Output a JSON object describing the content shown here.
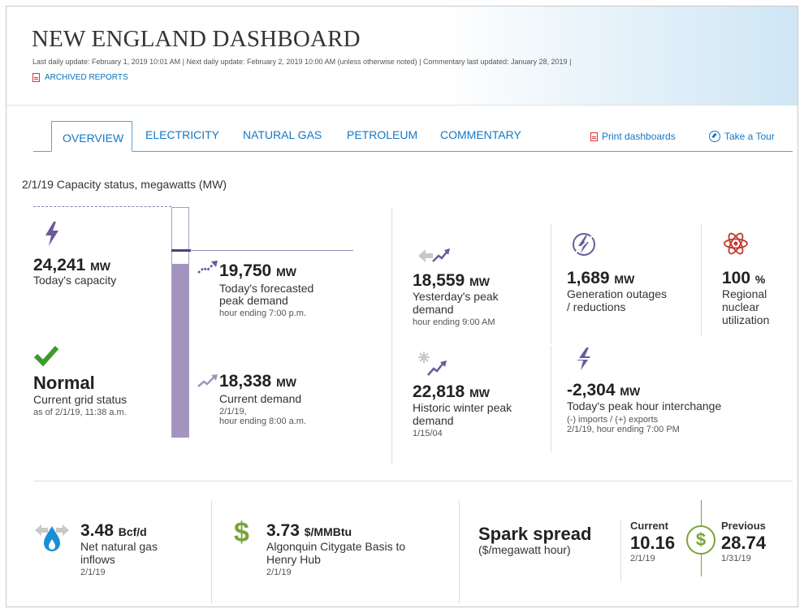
{
  "header": {
    "title": "NEW ENGLAND DASHBOARD",
    "updates": "Last daily update: February 1, 2019 10:01 AM  |  Next daily update: February 2, 2019 10:00 AM (unless otherwise noted)  |  Commentary last updated: January 28, 2019  |",
    "archived": "ARCHIVED REPORTS"
  },
  "tabs": [
    "OVERVIEW",
    "ELECTRICITY",
    "NATURAL GAS",
    "PETROLEUM",
    "COMMENTARY"
  ],
  "tools": {
    "print": "Print dashboards",
    "tour": "Take a Tour"
  },
  "capacity": {
    "section_title": "2/1/19 Capacity status, megawatts (MW)",
    "today_capacity": {
      "value": "24,241",
      "unit": "MW",
      "label": "Today's capacity"
    },
    "forecast": {
      "value": "19,750",
      "unit": "MW",
      "label1": "Today's forecasted",
      "label2": "peak demand",
      "sub": "hour ending 7:00 p.m."
    },
    "status": {
      "value": "Normal",
      "label": "Current grid status",
      "sub": "as of 2/1/19, 11:38 a.m."
    },
    "current": {
      "value": "18,338",
      "unit": "MW",
      "label": "Current demand",
      "sub1": "2/1/19,",
      "sub2": "hour ending 8:00 a.m."
    },
    "bar": {
      "capacity": 24241,
      "forecast": 19750,
      "current": 18338
    }
  },
  "stats": {
    "yesterday": {
      "value": "18,559",
      "unit": "MW",
      "label1": "Yesterday's peak",
      "label2": "demand",
      "sub": "hour ending 9:00 AM"
    },
    "outages": {
      "value": "1,689",
      "unit": "MW",
      "label1": "Generation outages",
      "label2": "/ reductions"
    },
    "nuclear": {
      "value": "100",
      "unit": "%",
      "label1": "Regional",
      "label2": "nuclear",
      "label3": "utilization"
    },
    "winter": {
      "value": "22,818",
      "unit": "MW",
      "label1": "Historic winter peak",
      "label2": "demand",
      "sub": "1/15/04"
    },
    "interchange": {
      "value": "-2,304",
      "unit": "MW",
      "label": "Today's peak hour interchange",
      "sub1": "(-) imports / (+) exports",
      "sub2": "2/1/19, hour ending 7:00 PM"
    }
  },
  "bottom": {
    "gas": {
      "value": "3.48",
      "unit": "Bcf/d",
      "label1": "Net natural gas",
      "label2": "inflows",
      "sub": "2/1/19"
    },
    "basis": {
      "value": "3.73",
      "unit": "$/MMBtu",
      "label1": "Algonquin Citygate Basis to",
      "label2": "Henry Hub",
      "sub": "2/1/19"
    },
    "spark": {
      "title": "Spark spread",
      "unit": "($/megawatt hour)",
      "current": {
        "label": "Current",
        "value": "10.16",
        "date": "2/1/19"
      },
      "previous": {
        "label": "Previous",
        "value": "28.74",
        "date": "1/31/19"
      }
    }
  },
  "colors": {
    "accent": "#1578c4",
    "purple": "#7b6aa5",
    "green": "#3e9a2e",
    "gas_blue": "#1a8fd6",
    "dollar_green": "#7aa33a"
  }
}
